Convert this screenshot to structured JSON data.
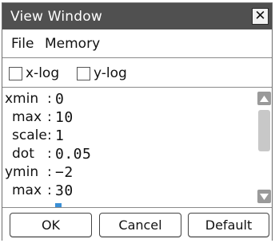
{
  "window": {
    "title": "View Window",
    "close_glyph": "✕"
  },
  "menu": {
    "items": [
      {
        "label": "File"
      },
      {
        "label": "Memory"
      }
    ]
  },
  "checkboxes": [
    {
      "label": "x-log",
      "checked": false
    },
    {
      "label": "y-log",
      "checked": false
    }
  ],
  "params": [
    {
      "label": "xmin",
      "value": "0"
    },
    {
      "label": "max",
      "value": "10"
    },
    {
      "label": "scale",
      "value": "1"
    },
    {
      "label": "dot",
      "value": "0.05"
    },
    {
      "label": "ymin",
      "value": "−2"
    },
    {
      "label": "max",
      "value": "30"
    }
  ],
  "buttons": {
    "ok": "OK",
    "cancel": "Cancel",
    "default": "Default"
  },
  "colors": {
    "titlebar": "#505050",
    "cursor": "#3a8fd6",
    "scroll_arrow": "#9a9a9a",
    "scroll_thumb": "#c8c8c8"
  }
}
